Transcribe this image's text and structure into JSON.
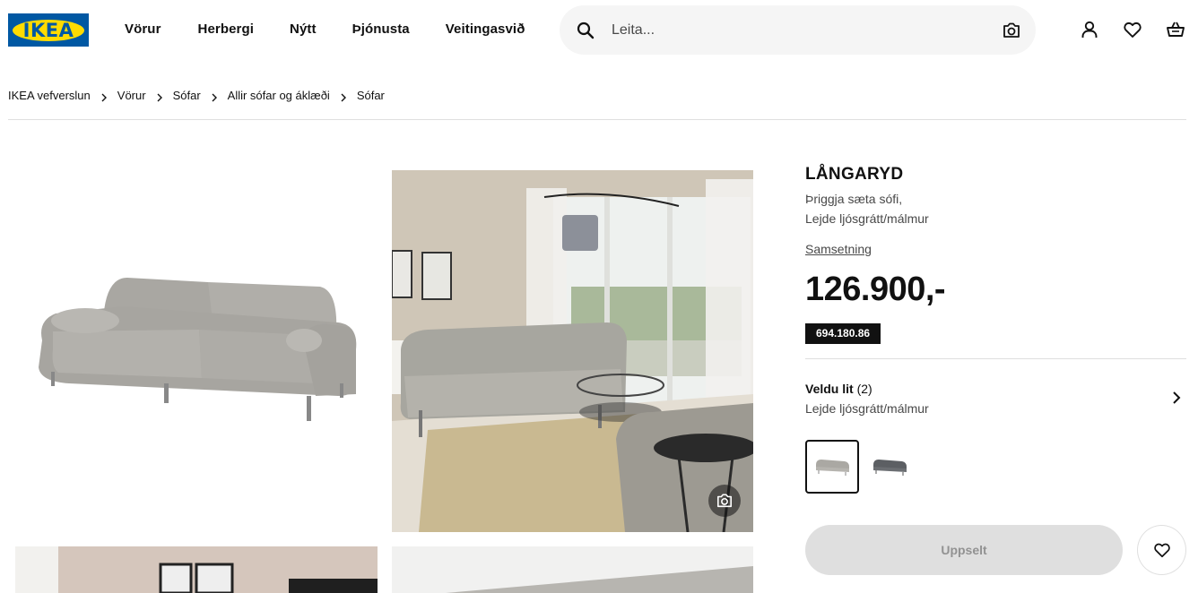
{
  "brand": {
    "logo_text": "IKEA",
    "blue": "#0058a3",
    "yellow": "#ffdb00"
  },
  "nav": {
    "items": [
      "Vörur",
      "Herbergi",
      "Nýtt",
      "Þjónusta",
      "Veitingasvið"
    ]
  },
  "search": {
    "placeholder": "Leita...",
    "icon": "search-icon",
    "camera_icon": "camera-icon"
  },
  "header_icons": [
    "user-icon",
    "heart-icon",
    "basket-icon"
  ],
  "breadcrumb": [
    "IKEA vefverslun",
    "Vörur",
    "Sófar",
    "Allir sófar og áklæði",
    "Sófar"
  ],
  "product": {
    "name": "LÅNGARYD",
    "desc_line1": "Þriggja sæta sófi,",
    "desc_line2": "Lejde ljósgrátt/málmur",
    "assembly_link": "Samsetning",
    "price": "126.900,-",
    "article_number": "694.180.86"
  },
  "color_picker": {
    "title": "Veldu lit",
    "count": "(2)",
    "selected": "Lejde ljósgrátt/málmur",
    "swatches": [
      "light-grey-sofa-swatch",
      "dark-grey-sofa-swatch"
    ]
  },
  "actions": {
    "buy_label": "Uppselt",
    "buy_disabled": true
  }
}
